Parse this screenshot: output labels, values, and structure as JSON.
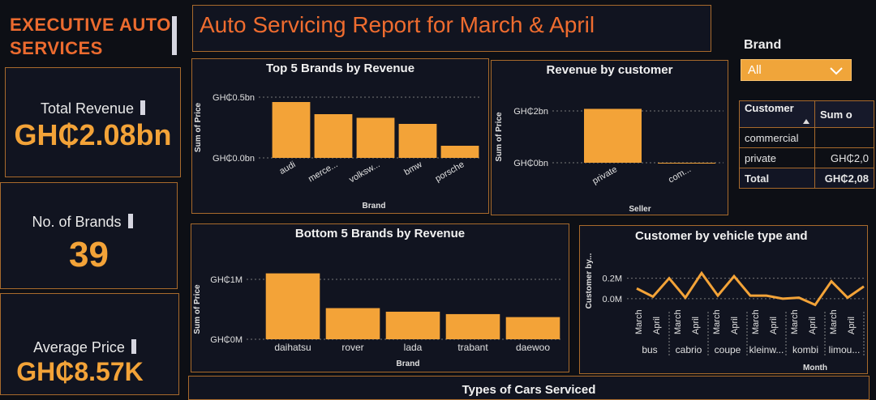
{
  "company": {
    "name": "EXECUTIVE AUTO SERVICES"
  },
  "report": {
    "title": "Auto Servicing Report for March & April"
  },
  "kpis": {
    "revenue": {
      "label": "Total Revenue",
      "value": "GH₵2.08bn"
    },
    "brands": {
      "label": "No. of Brands",
      "value": "39"
    },
    "avg": {
      "label": "Average Price",
      "value": "GH₵8.57K"
    }
  },
  "slicer": {
    "label": "Brand",
    "value": "All"
  },
  "table": {
    "headers": [
      "Customer",
      "Sum o"
    ],
    "rows": [
      [
        "commercial",
        ""
      ],
      [
        "private",
        "GH₵2,0"
      ]
    ],
    "total": [
      "Total",
      "GH₵2,08"
    ]
  },
  "colors": {
    "accent": "#f3a338",
    "title": "#ec6b2f",
    "border": "#a86a2c"
  },
  "icons": {
    "dropdown": "chevron-down-icon",
    "sort": "sort-ascending-icon"
  },
  "chart_data": [
    {
      "type": "bar",
      "title": "Top 5 Brands by Revenue",
      "xlabel": "Brand",
      "ylabel": "Sum of Price",
      "categories": [
        "audi",
        "merce...",
        "volksw...",
        "bmw",
        "porsche"
      ],
      "values": [
        0.46,
        0.36,
        0.33,
        0.28,
        0.1
      ],
      "yticks": [
        "GH₵0.0bn",
        "GH₵0.5bn"
      ],
      "ylim": [
        0,
        0.5
      ]
    },
    {
      "type": "bar",
      "title": "Revenue by customer",
      "xlabel": "Seller",
      "ylabel": "Sum of Price",
      "categories": [
        "private",
        "com..."
      ],
      "values": [
        2.08,
        0.0
      ],
      "yticks": [
        "GH₵0bn",
        "GH₵2bn"
      ],
      "ylim": [
        0,
        2
      ]
    },
    {
      "type": "bar",
      "title": "Bottom 5 Brands by Revenue",
      "xlabel": "Brand",
      "ylabel": "Sum of Price",
      "categories": [
        "daihatsu",
        "rover",
        "lada",
        "trabant",
        "daewoo"
      ],
      "values": [
        1.1,
        0.52,
        0.46,
        0.42,
        0.37
      ],
      "yticks": [
        "GH₵0M",
        "GH₵1M"
      ],
      "ylim": [
        0,
        1
      ]
    },
    {
      "type": "line",
      "title": "Customer by vehicle type and",
      "xlabel": "Month",
      "ylabel": "Customer by...",
      "groups": [
        "bus",
        "cabrio",
        "coupe",
        "kleinw...",
        "kombi",
        "limou..."
      ],
      "months": [
        "March",
        "April"
      ],
      "values": [
        0.1,
        0.02,
        0.2,
        0.01,
        0.25,
        0.03,
        0.22,
        0.03,
        0.03,
        0.0,
        0.01,
        -0.06,
        0.17,
        0.01,
        0.12
      ],
      "yticks": [
        "0.0M",
        "0.2M"
      ],
      "ylim": [
        -0.08,
        0.3
      ]
    }
  ],
  "bottom": {
    "title": "Types of Cars Serviced"
  }
}
